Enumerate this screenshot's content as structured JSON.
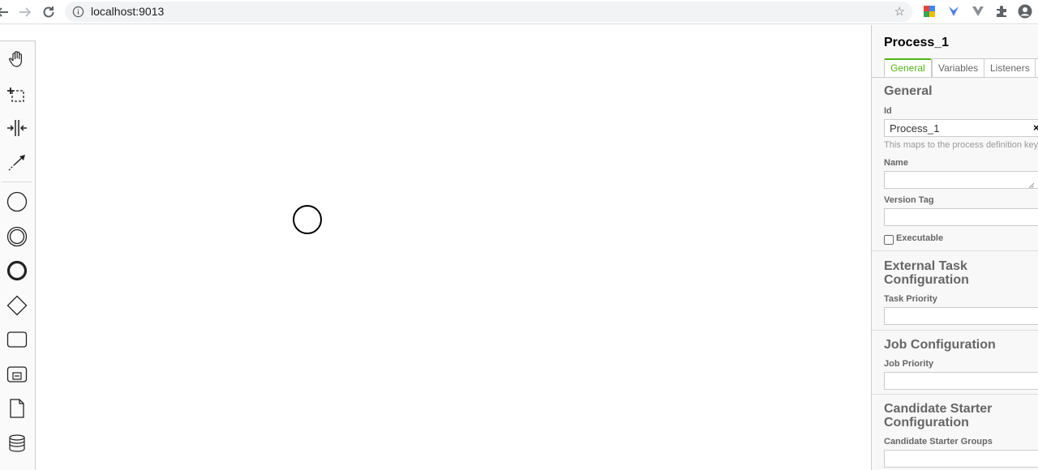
{
  "browser": {
    "url": "localhost:9013",
    "back_icon": "arrow-left-icon",
    "forward_icon": "arrow-right-icon",
    "reload_icon": "reload-icon"
  },
  "palette": {
    "tools": [
      {
        "name": "hand-tool",
        "icon": "hand-icon"
      },
      {
        "name": "lasso-tool",
        "icon": "lasso-icon"
      },
      {
        "name": "space-tool",
        "icon": "space-icon"
      },
      {
        "name": "global-connect-tool",
        "icon": "connect-arrow-icon"
      },
      {
        "name": "create-start-event",
        "icon": "start-event-icon"
      },
      {
        "name": "create-intermediate-event",
        "icon": "intermediate-event-icon"
      },
      {
        "name": "create-end-event",
        "icon": "end-event-icon"
      },
      {
        "name": "create-gateway",
        "icon": "gateway-icon"
      },
      {
        "name": "create-task",
        "icon": "task-icon"
      },
      {
        "name": "create-subprocess",
        "icon": "subprocess-icon"
      },
      {
        "name": "create-data-object",
        "icon": "data-object-icon"
      },
      {
        "name": "create-data-store",
        "icon": "data-store-icon"
      }
    ]
  },
  "properties": {
    "title": "Process_1",
    "tabs": [
      {
        "label": "General",
        "active": true
      },
      {
        "label": "Variables",
        "active": false
      },
      {
        "label": "Listeners",
        "active": false
      }
    ],
    "general": {
      "heading": "General",
      "id_label": "Id",
      "id_value": "Process_1",
      "id_clear": "×",
      "id_hint": "This maps to the process definition key.",
      "name_label": "Name",
      "name_value": "",
      "version_tag_label": "Version Tag",
      "version_tag_value": "",
      "executable_label": "Executable"
    },
    "external_task": {
      "heading_line1": "External Task",
      "heading_line2": "Configuration",
      "priority_label": "Task Priority"
    },
    "job": {
      "heading": "Job Configuration",
      "priority_label": "Job Priority"
    },
    "candidate_starter": {
      "heading_line1": "Candidate Starter",
      "heading_line2": "Configuration",
      "groups_label": "Candidate Starter Groups"
    }
  },
  "colors": {
    "accent": "#52b415",
    "panel_bg": "#f8f8f8",
    "label": "#666666"
  }
}
